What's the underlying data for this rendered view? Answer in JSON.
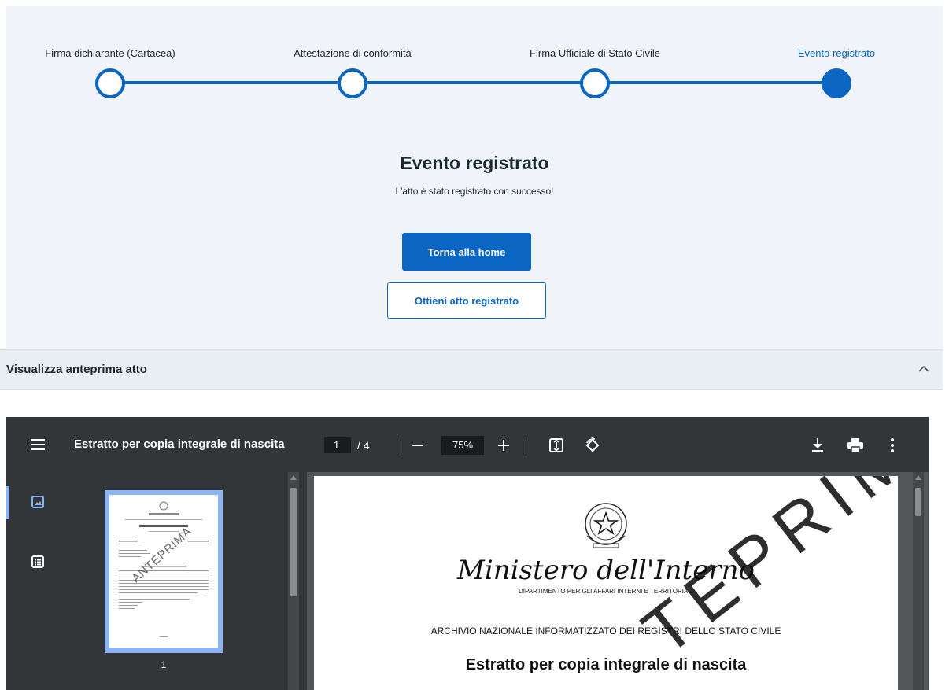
{
  "stepper": {
    "steps": [
      {
        "label": "Firma dichiarante (Cartacea)",
        "state": "completed"
      },
      {
        "label": "Attestazione di conformità",
        "state": "completed"
      },
      {
        "label": "Firma Ufficiale di Stato Civile",
        "state": "completed"
      },
      {
        "label": "Evento registrato",
        "state": "active"
      }
    ]
  },
  "result": {
    "title": "Evento registrato",
    "subtitle": "L'atto è stato registrato con successo!",
    "home_button": "Torna alla home",
    "get_act_button": "Ottieni atto registrato"
  },
  "accordion": {
    "label": "Visualizza anteprima atto"
  },
  "pdf_viewer": {
    "title": "Estratto per copia integrale di nascita",
    "current_page": "1",
    "total_pages": "/ 4",
    "zoom": "75%",
    "thumbnail_page_number": "1",
    "thumbnail_watermark": "ANTEPRIMA",
    "page": {
      "ministry": "Ministero dell'Interno",
      "department": "DIPARTIMENTO PER GLI AFFARI INTERNI E TERRITORIALI",
      "archive": "ARCHIVIO NAZIONALE INFORMATIZZATO DEI REGISTRI DELLO STATO CIVILE",
      "extract_title": "Estratto per copia integrale di nascita",
      "watermark": "TEPRIMA"
    }
  },
  "colors": {
    "primary": "#0a66c2",
    "background": "#f0f4fa",
    "viewer_toolbar": "#323639",
    "thumbnail_highlight": "#8ab4f8"
  }
}
